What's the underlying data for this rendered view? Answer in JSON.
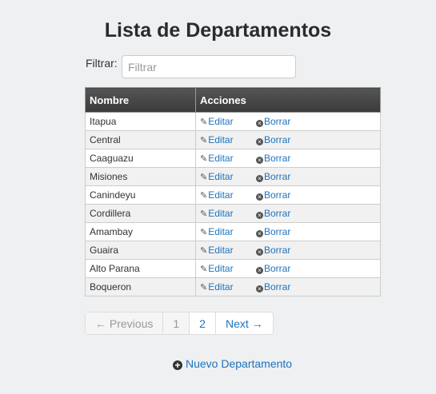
{
  "page": {
    "title": "Lista de Departamentos"
  },
  "filter": {
    "label": "Filtrar:",
    "placeholder": "Filtrar",
    "value": ""
  },
  "table": {
    "headers": [
      "Nombre",
      "Acciones"
    ],
    "edit_label": "Editar",
    "delete_label": "Borrar",
    "rows": [
      "Itapua",
      "Central",
      "Caaguazu",
      "Misiones",
      "Canindeyu",
      "Cordillera",
      "Amambay",
      "Guaira",
      "Alto Parana",
      "Boqueron"
    ]
  },
  "pagination": {
    "previous": "← Previous",
    "pages": [
      "1",
      "2"
    ],
    "next": "Next →"
  },
  "actions": {
    "new": "Nuevo Departamento"
  },
  "colors": {
    "link": "#1e73be",
    "header_bg": "#444444",
    "page_bg": "#eef0f2"
  },
  "icons": {
    "edit": "edit-icon",
    "delete": "remove-circle-icon",
    "add": "plus-circle-icon"
  }
}
